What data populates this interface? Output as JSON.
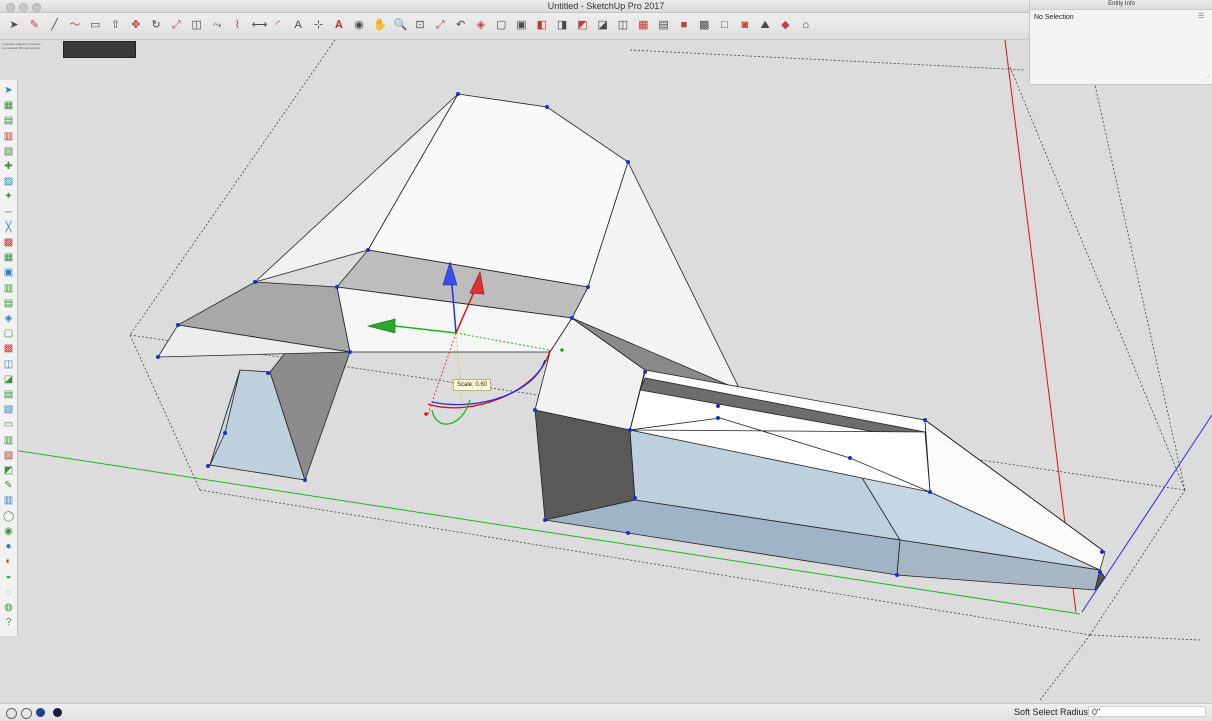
{
  "window": {
    "title": "Untitled - SketchUp Pro 2017"
  },
  "colors": {
    "accent_red": "#d93a2b",
    "axis_red": "#e01010",
    "axis_green": "#18b818",
    "axis_blue": "#2030e0",
    "face_white": "#f8f8f8",
    "face_back": "#b8c8d6"
  },
  "toolbar": {
    "icons": [
      "select-icon",
      "paint-icon",
      "line-icon",
      "freehand-icon",
      "rectangle-icon",
      "push-pull-icon",
      "move-icon",
      "rotate-icon",
      "scale-icon",
      "offset-icon",
      "follow-me-icon",
      "tape-measure-icon",
      "dimension-icon",
      "protractor-icon",
      "text-icon",
      "axes-icon",
      "3d-text-icon",
      "orbit-icon",
      "pan-icon",
      "zoom-icon",
      "zoom-window-icon",
      "zoom-extents-icon",
      "previous-view-icon",
      "iso-view-icon",
      "top-view-icon",
      "front-view-icon",
      "right-view-icon",
      "back-view-icon",
      "left-view-icon",
      "xray-icon",
      "back-edges-icon",
      "wireframe-icon",
      "hidden-line-icon",
      "shaded-icon",
      "textured-icon",
      "monochrome-icon",
      "section-plane-icon",
      "sandbox-icon",
      "extension-icon",
      "component-icon"
    ]
  },
  "instructor": {
    "hint": "3 vertices selected\n2 vertices not selected\n38 total vertices"
  },
  "entity_info": {
    "panel_title": "Entity Info",
    "selection": "No Selection"
  },
  "tooltip": {
    "label": "Scale: 0.60"
  },
  "status": {
    "measurement_label": "Soft Select Radius",
    "measurement_value": "0\""
  }
}
